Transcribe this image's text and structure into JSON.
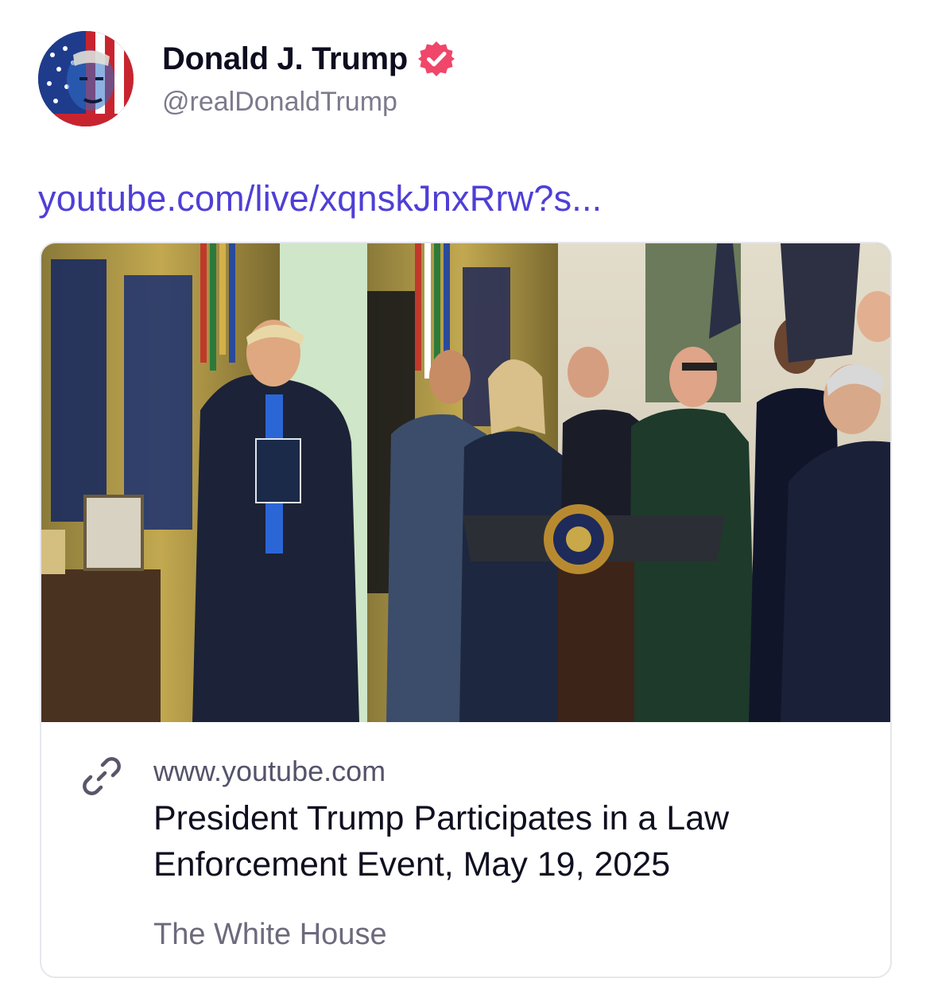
{
  "post": {
    "author": {
      "display_name": "Donald J. Trump",
      "handle": "@realDonaldTrump",
      "verified": true,
      "avatar_icon": "avatar-image",
      "verified_icon": "verified-badge-icon"
    },
    "link_text": "youtube.com/live/xqnskJnxRrw?s...",
    "link_card": {
      "thumbnail": "video-thumbnail-image",
      "link_icon": "link-icon",
      "domain": "www.youtube.com",
      "title": "President Trump Participates in a Law Enforcement Event, May 19, 2025",
      "source": "The White House"
    }
  },
  "colors": {
    "link": "#4f3fd6",
    "verified_badge": "#f0466a",
    "handle": "#7c7a8c",
    "card_border": "#e6e6ec"
  }
}
